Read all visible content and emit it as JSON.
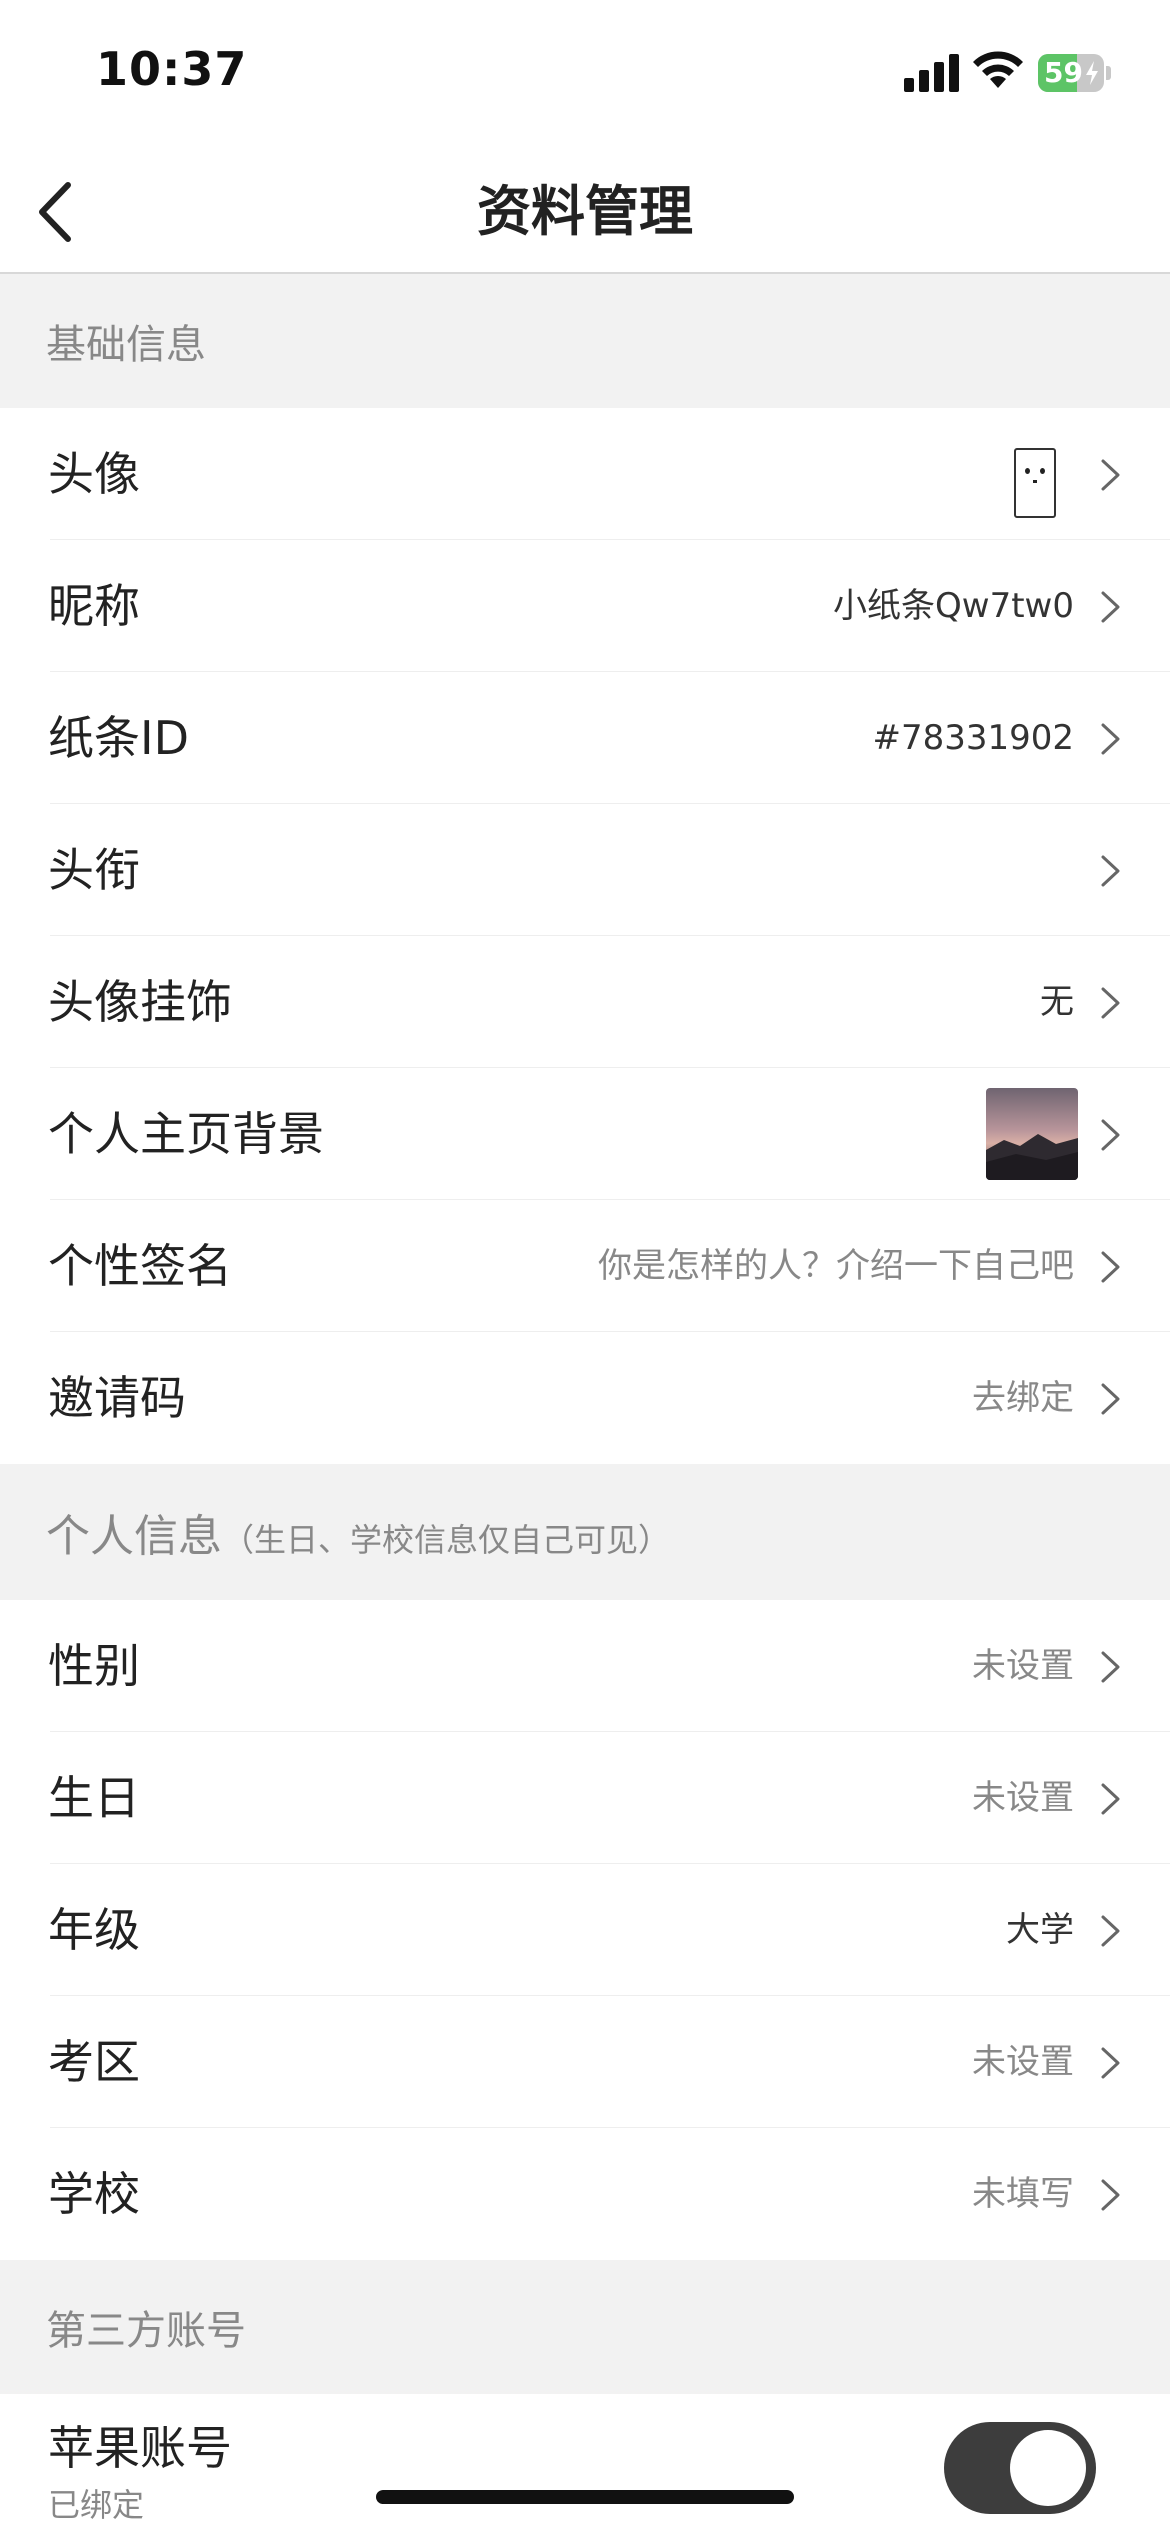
{
  "status_bar": {
    "time": "10:37",
    "battery_percent": 59,
    "battery_label": "59",
    "battery_charging": true,
    "battery_color": "#5dc466"
  },
  "nav": {
    "title": "资料管理",
    "back_icon": "chevron-left-icon"
  },
  "sections": {
    "basic": {
      "label": "基础信息"
    },
    "personal": {
      "label": "个人信息",
      "hint": "（生日、学校信息仅自己可见）"
    },
    "third_party": {
      "label": "第三方账号"
    }
  },
  "basic_rows": {
    "avatar": {
      "label": "头像"
    },
    "nickname": {
      "label": "昵称",
      "value": "小纸条Qw7tw0"
    },
    "note_id": {
      "label": "纸条ID",
      "value": "#78331902"
    },
    "title": {
      "label": "头衔",
      "value": ""
    },
    "avatar_frame": {
      "label": "头像挂饰",
      "value": "无"
    },
    "profile_bg": {
      "label": "个人主页背景"
    },
    "signature": {
      "label": "个性签名",
      "value": "你是怎样的人？介绍一下自己吧"
    },
    "invite_code": {
      "label": "邀请码",
      "value": "去绑定"
    }
  },
  "personal_rows": {
    "gender": {
      "label": "性别",
      "value": "未设置"
    },
    "birthday": {
      "label": "生日",
      "value": "未设置"
    },
    "grade": {
      "label": "年级",
      "value": "大学"
    },
    "exam_region": {
      "label": "考区",
      "value": "未设置"
    },
    "school": {
      "label": "学校",
      "value": "未填写"
    }
  },
  "third_party_rows": {
    "apple": {
      "label": "苹果账号",
      "status": "已绑定",
      "toggle_on": true
    }
  },
  "colors": {
    "section_bg": "#f2f2f2",
    "toggle_on": "#3d3d3d",
    "muted_text": "#888888"
  }
}
